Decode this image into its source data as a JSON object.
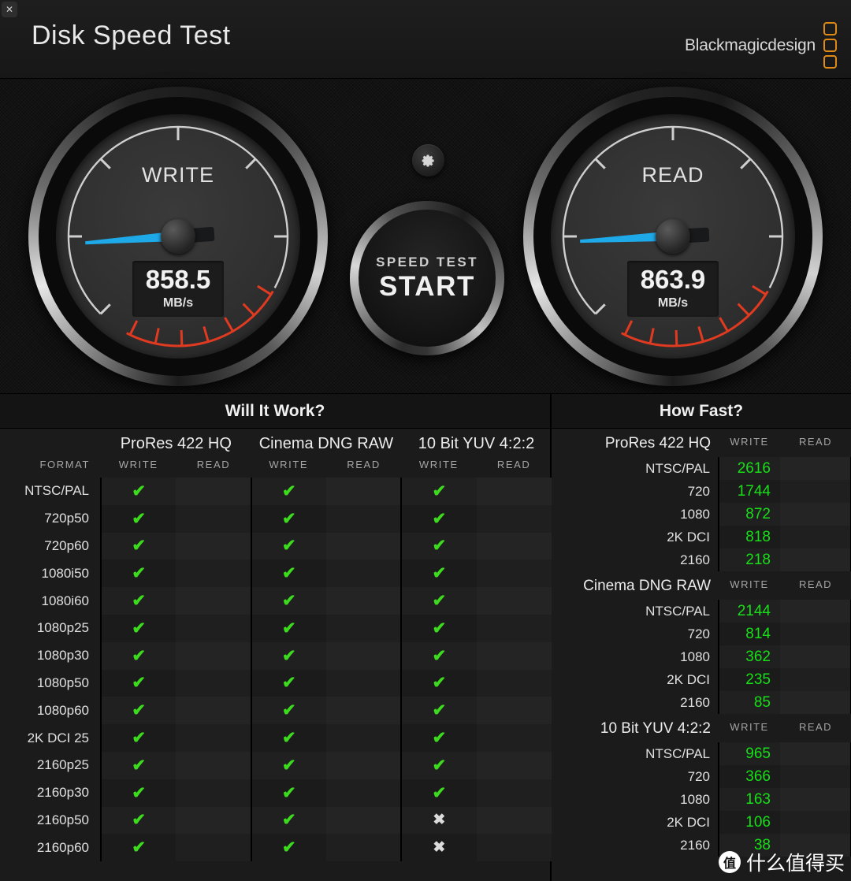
{
  "window": {
    "close_label": "✕"
  },
  "header": {
    "title": "Disk Speed Test",
    "brand": "Blackmagicdesign",
    "brand_color": "#e08a16"
  },
  "gauges": {
    "write": {
      "label": "WRITE",
      "value": "858.5",
      "unit": "MB/s",
      "needle_angle_deg": -184
    },
    "read": {
      "label": "READ",
      "value": "863.9",
      "unit": "MB/s",
      "needle_angle_deg": -183
    },
    "needle_color": "#1ea9e8",
    "redzone_color": "#e03a20"
  },
  "controls": {
    "gear_icon": "gear-icon",
    "start_line1": "SPEED TEST",
    "start_line2": "START"
  },
  "will_it_work": {
    "title": "Will It Work?",
    "format_header": "FORMAT",
    "codecs": [
      "ProRes 422 HQ",
      "Cinema DNG RAW",
      "10 Bit YUV 4:2:2"
    ],
    "sub_headers": [
      "WRITE",
      "READ"
    ],
    "tick_glyph": "✔",
    "cross_glyph": "✖",
    "tick_color": "#3ddb1e",
    "cross_color": "#dcdcdc",
    "rows": [
      {
        "format": "NTSC/PAL",
        "cells": [
          "tick",
          "",
          "tick",
          "",
          "tick",
          ""
        ]
      },
      {
        "format": "720p50",
        "cells": [
          "tick",
          "",
          "tick",
          "",
          "tick",
          ""
        ]
      },
      {
        "format": "720p60",
        "cells": [
          "tick",
          "",
          "tick",
          "",
          "tick",
          ""
        ]
      },
      {
        "format": "1080i50",
        "cells": [
          "tick",
          "",
          "tick",
          "",
          "tick",
          ""
        ]
      },
      {
        "format": "1080i60",
        "cells": [
          "tick",
          "",
          "tick",
          "",
          "tick",
          ""
        ]
      },
      {
        "format": "1080p25",
        "cells": [
          "tick",
          "",
          "tick",
          "",
          "tick",
          ""
        ]
      },
      {
        "format": "1080p30",
        "cells": [
          "tick",
          "",
          "tick",
          "",
          "tick",
          ""
        ]
      },
      {
        "format": "1080p50",
        "cells": [
          "tick",
          "",
          "tick",
          "",
          "tick",
          ""
        ]
      },
      {
        "format": "1080p60",
        "cells": [
          "tick",
          "",
          "tick",
          "",
          "tick",
          ""
        ]
      },
      {
        "format": "2K DCI 25",
        "cells": [
          "tick",
          "",
          "tick",
          "",
          "tick",
          ""
        ]
      },
      {
        "format": "2160p25",
        "cells": [
          "tick",
          "",
          "tick",
          "",
          "tick",
          ""
        ]
      },
      {
        "format": "2160p30",
        "cells": [
          "tick",
          "",
          "tick",
          "",
          "tick",
          ""
        ]
      },
      {
        "format": "2160p50",
        "cells": [
          "tick",
          "",
          "tick",
          "",
          "cross",
          ""
        ]
      },
      {
        "format": "2160p60",
        "cells": [
          "tick",
          "",
          "tick",
          "",
          "cross",
          ""
        ]
      }
    ]
  },
  "how_fast": {
    "title": "How Fast?",
    "sub_headers": [
      "WRITE",
      "READ"
    ],
    "value_color": "#17e017",
    "groups": [
      {
        "codec": "ProRes 422 HQ",
        "rows": [
          {
            "res": "NTSC/PAL",
            "write": "2616",
            "read": ""
          },
          {
            "res": "720",
            "write": "1744",
            "read": ""
          },
          {
            "res": "1080",
            "write": "872",
            "read": ""
          },
          {
            "res": "2K DCI",
            "write": "818",
            "read": ""
          },
          {
            "res": "2160",
            "write": "218",
            "read": ""
          }
        ]
      },
      {
        "codec": "Cinema DNG RAW",
        "rows": [
          {
            "res": "NTSC/PAL",
            "write": "2144",
            "read": ""
          },
          {
            "res": "720",
            "write": "814",
            "read": ""
          },
          {
            "res": "1080",
            "write": "362",
            "read": ""
          },
          {
            "res": "2K DCI",
            "write": "235",
            "read": ""
          },
          {
            "res": "2160",
            "write": "85",
            "read": ""
          }
        ]
      },
      {
        "codec": "10 Bit YUV 4:2:2",
        "rows": [
          {
            "res": "NTSC/PAL",
            "write": "965",
            "read": ""
          },
          {
            "res": "720",
            "write": "366",
            "read": ""
          },
          {
            "res": "1080",
            "write": "163",
            "read": ""
          },
          {
            "res": "2K DCI",
            "write": "106",
            "read": ""
          },
          {
            "res": "2160",
            "write": "38",
            "read": ""
          }
        ]
      }
    ]
  },
  "watermark": {
    "logo": "值",
    "text": "什么值得买"
  }
}
